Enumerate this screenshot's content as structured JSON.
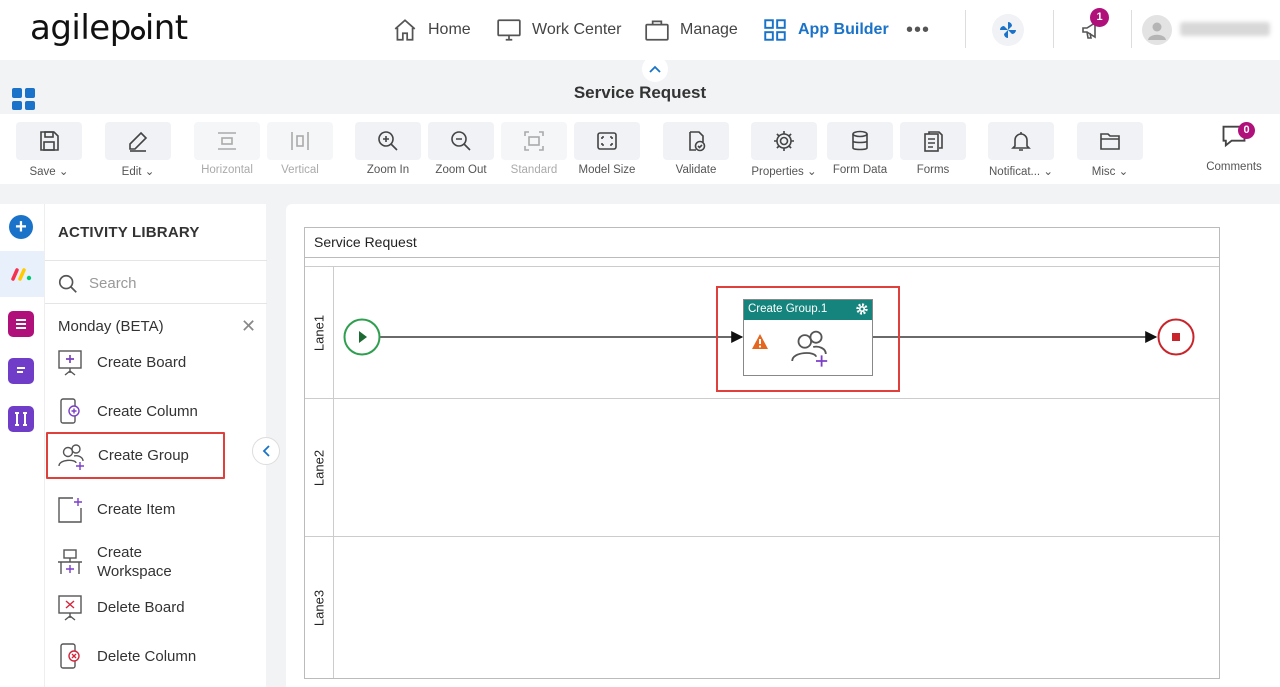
{
  "topnav": {
    "logo": "agilepoint",
    "items": [
      {
        "label": "Home",
        "icon": "home-icon"
      },
      {
        "label": "Work Center",
        "icon": "monitor-icon"
      },
      {
        "label": "Manage",
        "icon": "briefcase-icon"
      },
      {
        "label": "App Builder",
        "icon": "apps-grid-icon",
        "active": true
      }
    ],
    "more": "•••",
    "notification_count": "1"
  },
  "page": {
    "title": "Service Request"
  },
  "toolbar": {
    "items": [
      {
        "label": "Save",
        "icon": "save-icon",
        "dropdown": true
      },
      {
        "label": "Edit",
        "icon": "pencil-icon",
        "dropdown": true
      },
      {
        "label": "Horizontal",
        "icon": "horizontal-icon",
        "disabled": true
      },
      {
        "label": "Vertical",
        "icon": "vertical-icon",
        "disabled": true
      },
      {
        "label": "Zoom In",
        "icon": "zoom-in-icon"
      },
      {
        "label": "Zoom Out",
        "icon": "zoom-out-icon"
      },
      {
        "label": "Standard",
        "icon": "standard-icon",
        "disabled": true
      },
      {
        "label": "Model Size",
        "icon": "model-size-icon"
      },
      {
        "label": "Validate",
        "icon": "validate-icon"
      },
      {
        "label": "Properties",
        "icon": "gear-icon",
        "dropdown": true
      },
      {
        "label": "Form Data",
        "icon": "database-icon"
      },
      {
        "label": "Forms",
        "icon": "forms-icon"
      },
      {
        "label": "Notificat...",
        "icon": "bell-icon",
        "dropdown": true
      },
      {
        "label": "Misc",
        "icon": "folder-icon",
        "dropdown": true
      }
    ],
    "comments_label": "Comments",
    "comments_count": "0"
  },
  "library": {
    "title": "ACTIVITY LIBRARY",
    "search_placeholder": "Search",
    "group": "Monday (BETA)",
    "items": [
      {
        "label": "Create Board"
      },
      {
        "label": "Create Column"
      },
      {
        "label": "Create Group"
      },
      {
        "label": "Create Item"
      },
      {
        "label": "Create Workspace"
      },
      {
        "label": "Delete Board"
      },
      {
        "label": "Delete Column"
      }
    ]
  },
  "diagram": {
    "pool_title": "Service Request",
    "lanes": [
      "Lane1",
      "Lane2",
      "Lane3"
    ],
    "activity_title": "Create Group.1"
  },
  "colors": {
    "accent": "#1a73c8",
    "highlight": "#e0403c",
    "activity_header": "#15847d",
    "start": "#2e9e4f",
    "end": "#c8242b"
  }
}
